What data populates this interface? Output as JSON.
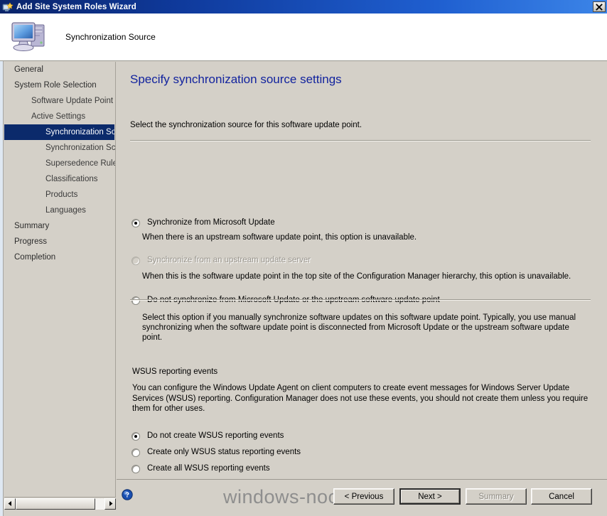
{
  "window": {
    "title": "Add Site System Roles Wizard",
    "close_label": "Close",
    "icon": "site-system-wizard-icon"
  },
  "banner": {
    "title": "Synchronization Source",
    "icon": "computer-icon"
  },
  "sidebar": {
    "items": [
      {
        "label": "General",
        "level": 1,
        "selected": false
      },
      {
        "label": "System Role Selection",
        "level": 1,
        "selected": false
      },
      {
        "label": "Software Update Point",
        "level": 2,
        "selected": false
      },
      {
        "label": "Active Settings",
        "level": 2,
        "selected": false
      },
      {
        "label": "Synchronization Source",
        "level": 3,
        "selected": true
      },
      {
        "label": "Synchronization Schedule",
        "level": 3,
        "selected": false
      },
      {
        "label": "Supersedence Rules",
        "level": 3,
        "selected": false
      },
      {
        "label": "Classifications",
        "level": 3,
        "selected": false
      },
      {
        "label": "Products",
        "level": 3,
        "selected": false
      },
      {
        "label": "Languages",
        "level": 3,
        "selected": false
      },
      {
        "label": "Summary",
        "level": 1,
        "selected": false
      },
      {
        "label": "Progress",
        "level": 1,
        "selected": false
      },
      {
        "label": "Completion",
        "level": 1,
        "selected": false
      }
    ],
    "scrollbar": {
      "left_arrow": "◄",
      "right_arrow": "►"
    }
  },
  "main": {
    "page_title": "Specify synchronization source settings",
    "intro": "Select the synchronization source for this software update point.",
    "source_options": [
      {
        "label": "Synchronize from Microsoft Update",
        "description": "When there is an upstream software update point, this option is unavailable.",
        "checked": true,
        "disabled": false
      },
      {
        "label": "Synchronize from an upstream update server",
        "description": "When this is the software update point in the top site of the Configuration Manager hierarchy, this option is unavailable.",
        "checked": false,
        "disabled": true
      },
      {
        "label": "Do not synchronize from Microsoft Update or the upstream software update point",
        "description": "Select this option if you manually synchronize software updates on this software update point. Typically, you use manual synchronizing when the software update point is disconnected from Microsoft Update or the upstream software update point.",
        "checked": false,
        "disabled": false
      }
    ],
    "wsus_group": {
      "label": "WSUS reporting events",
      "description": "You can configure the Windows Update Agent on client computers to create event messages for Windows Server Update Services (WSUS) reporting. Configuration Manager does not use these events, you should not create them unless you require them for other uses.",
      "options": [
        {
          "label": "Do not create WSUS reporting events",
          "checked": true
        },
        {
          "label": "Create only WSUS status reporting events",
          "checked": false
        },
        {
          "label": "Create all WSUS reporting events",
          "checked": false
        }
      ]
    }
  },
  "footer": {
    "help_icon": "help-icon",
    "watermark": "windows-noob.com",
    "buttons": [
      {
        "label": "< Previous",
        "disabled": false,
        "default": false
      },
      {
        "label": "Next >",
        "disabled": false,
        "default": true
      },
      {
        "label": "Summary",
        "disabled": true,
        "default": false
      },
      {
        "label": "Cancel",
        "disabled": false,
        "default": false
      }
    ]
  },
  "colors": {
    "titlebar_start": "#0a246a",
    "titlebar_end": "#3c85e8",
    "selection": "#0b2a6b",
    "page_title": "#12239e",
    "face": "#d4d0c8",
    "watermark": "#8e8e8e"
  }
}
